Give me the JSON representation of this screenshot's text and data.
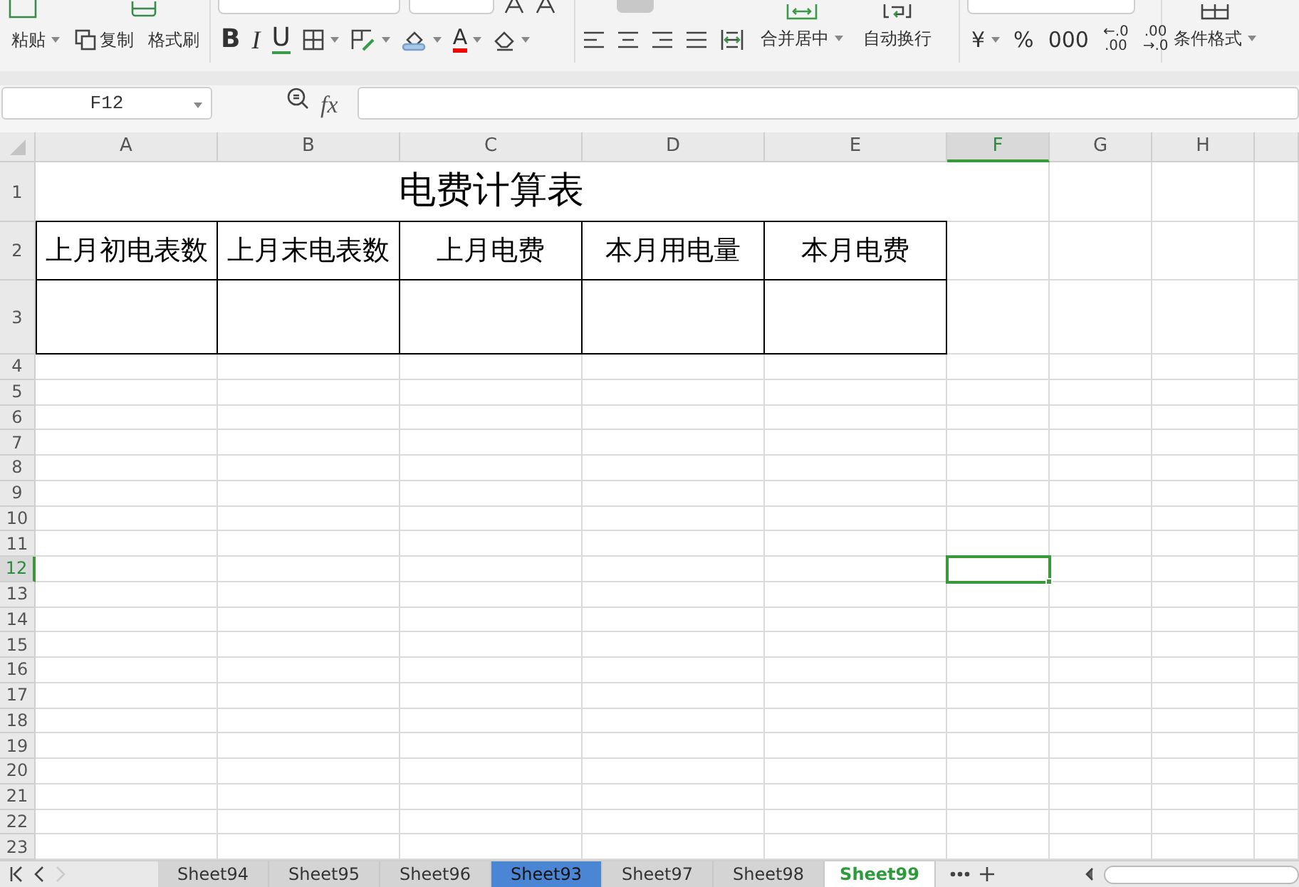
{
  "ribbon": {
    "clipboard": [
      {
        "kind": "paste",
        "label": "粘贴",
        "dropdown": true
      },
      {
        "kind": "copy",
        "label": "复制",
        "dropdown": false
      },
      {
        "kind": "painter",
        "label": "格式刷",
        "dropdown": false
      }
    ],
    "font_tools": [
      {
        "kind": "bold",
        "text": "B",
        "dropdown": false
      },
      {
        "kind": "italic",
        "text": "I",
        "dropdown": false
      },
      {
        "kind": "underline",
        "text": "U",
        "dropdown": false
      },
      {
        "kind": "border",
        "dropdown": true
      },
      {
        "kind": "shading",
        "dropdown": true
      },
      {
        "kind": "fill",
        "dropdown": true
      },
      {
        "kind": "font-color",
        "text": "A",
        "dropdown": true
      },
      {
        "kind": "eraser",
        "dropdown": true
      }
    ],
    "align_tools": [
      {
        "kind": "left"
      },
      {
        "kind": "center"
      },
      {
        "kind": "right"
      },
      {
        "kind": "justify"
      },
      {
        "kind": "distribute"
      }
    ],
    "align_buttons": [
      {
        "kind": "merge",
        "label": "合并居中",
        "dropdown": true
      },
      {
        "kind": "wrap",
        "label": "自动换行",
        "dropdown": false
      }
    ],
    "number_tools": [
      {
        "lines": [
          "¥"
        ],
        "dropdown": true
      },
      {
        "lines": [
          "%"
        ],
        "dropdown": false
      },
      {
        "lines": [
          "000"
        ],
        "dropdown": false
      },
      {
        "lines": [
          "←.0",
          ".00"
        ],
        "dropdown": false
      },
      {
        "lines": [
          ".00",
          "→.0"
        ],
        "dropdown": false
      }
    ],
    "style_buttons": [
      {
        "kind": "conditional",
        "label": "条件格式",
        "dropdown": true
      }
    ]
  },
  "formula_bar": {
    "name_box": "F12",
    "fx": "fx"
  },
  "sheet": {
    "columns": [
      {
        "label": "A",
        "selected": false
      },
      {
        "label": "B",
        "selected": false
      },
      {
        "label": "C",
        "selected": false
      },
      {
        "label": "D",
        "selected": false
      },
      {
        "label": "E",
        "selected": false
      },
      {
        "label": "F",
        "selected": true
      },
      {
        "label": "G",
        "selected": false
      },
      {
        "label": "H",
        "selected": false
      }
    ],
    "rows": [
      {
        "label": "1",
        "selected": false
      },
      {
        "label": "2",
        "selected": false
      },
      {
        "label": "3",
        "selected": false
      },
      {
        "label": "4",
        "selected": false
      },
      {
        "label": "5",
        "selected": false
      },
      {
        "label": "6",
        "selected": false
      },
      {
        "label": "7",
        "selected": false
      },
      {
        "label": "8",
        "selected": false
      },
      {
        "label": "9",
        "selected": false
      },
      {
        "label": "10",
        "selected": false
      },
      {
        "label": "11",
        "selected": false
      },
      {
        "label": "12",
        "selected": true
      },
      {
        "label": "13",
        "selected": false
      },
      {
        "label": "14",
        "selected": false
      },
      {
        "label": "15",
        "selected": false
      },
      {
        "label": "16",
        "selected": false
      },
      {
        "label": "17",
        "selected": false
      },
      {
        "label": "18",
        "selected": false
      },
      {
        "label": "19",
        "selected": false
      },
      {
        "label": "20",
        "selected": false
      },
      {
        "label": "21",
        "selected": false
      },
      {
        "label": "22",
        "selected": false
      },
      {
        "label": "23",
        "selected": false
      }
    ],
    "table_title": "电费计算表",
    "table_headers": [
      "上月初电表数",
      "上月末电表数",
      "上月电费",
      "本月用电量",
      "本月电费"
    ]
  },
  "sheet_tabs": [
    {
      "label": "Sheet94",
      "selected": false,
      "highlighted": false
    },
    {
      "label": "Sheet95",
      "selected": false,
      "highlighted": false
    },
    {
      "label": "Sheet96",
      "selected": false,
      "highlighted": false
    },
    {
      "label": "Sheet93",
      "selected": false,
      "highlighted": true
    },
    {
      "label": "Sheet97",
      "selected": false,
      "highlighted": false
    },
    {
      "label": "Sheet98",
      "selected": false,
      "highlighted": false
    },
    {
      "label": "Sheet99",
      "selected": true,
      "highlighted": false
    }
  ]
}
